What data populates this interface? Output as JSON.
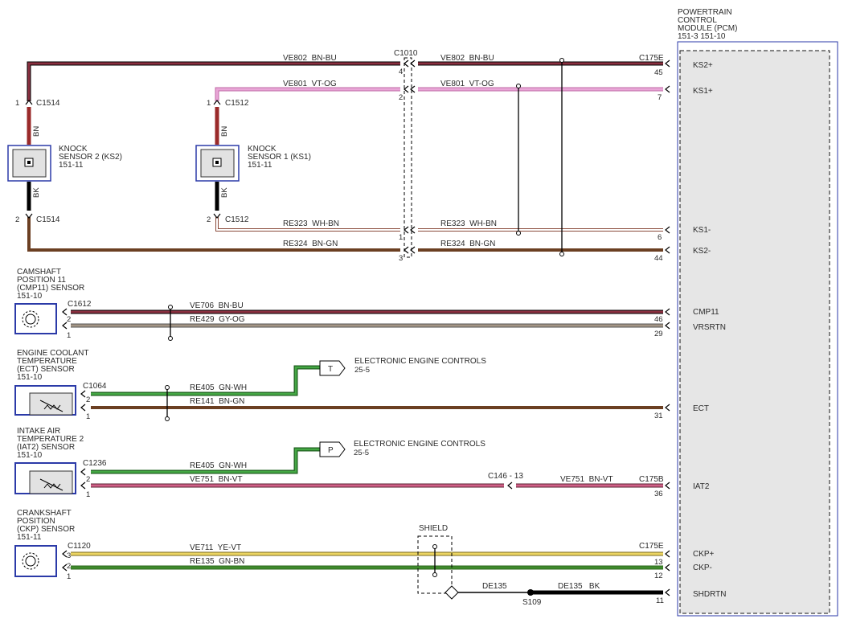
{
  "pcm": {
    "title_lines": [
      "POWERTRAIN",
      "CONTROL",
      "MODULE (PCM)",
      "151-3   151-10"
    ],
    "pins": [
      "KS2+",
      "KS1+",
      "KS1-",
      "KS2-",
      "CMP11",
      "VRSRTN",
      "ECT",
      "IAT2",
      "CKP+",
      "CKP-",
      "SHDRTN"
    ]
  },
  "knock_sensor_2": {
    "label_lines": [
      "KNOCK",
      "SENSOR 2 (KS2)",
      "151-11"
    ],
    "conn": "C1514",
    "pin_top": "1",
    "pin_bottom": "2",
    "wire_top_color": "BN",
    "wire_bottom_color": "BK"
  },
  "knock_sensor_1": {
    "label_lines": [
      "KNOCK",
      "SENSOR 1 (KS1)",
      "151-11"
    ],
    "conn": "C1512",
    "pin_top": "1",
    "pin_bottom": "2",
    "wire_top_color": "BN",
    "wire_bottom_color": "BK"
  },
  "c1010": {
    "name": "C1010",
    "pins": [
      "4",
      "2",
      "1",
      "3"
    ]
  },
  "c175e_top": {
    "name": "C175E",
    "pins": [
      "45",
      "7",
      "6",
      "44"
    ]
  },
  "ks_wires": [
    {
      "left": "VE802  BN-BU",
      "right": "VE802  BN-BU",
      "color": "#8a3040"
    },
    {
      "left": "VE801  VT-OG",
      "right": "VE801  VT-OG",
      "color": "#e79ad1"
    },
    {
      "left": "RE323  WH-BN",
      "right": "RE323  WH-BN",
      "color": "#ffffff"
    },
    {
      "left": "RE324  BN-GN",
      "right": "RE324  BN-GN",
      "color": "#7a4a2a"
    }
  ],
  "cmp_sensor": {
    "label_lines": [
      "CAMSHAFT",
      "POSITION 11",
      "(CMP11) SENSOR",
      "151-10"
    ],
    "conn": "C1612",
    "pins": [
      "2",
      "1"
    ],
    "wires": [
      {
        "circuit": "VE706  BN-BU",
        "pcm_pin": "46",
        "color": "#8a3040"
      },
      {
        "circuit": "RE429  GY-OG",
        "pcm_pin": "29",
        "color": "#9a8e80"
      }
    ]
  },
  "ect_sensor": {
    "label_lines": [
      "ENGINE COOLANT",
      "TEMPERATURE",
      "(ECT) SENSOR",
      "151-10"
    ],
    "conn": "C1064",
    "pins": [
      "2",
      "1"
    ],
    "wires": [
      {
        "circuit": "RE405  GN-WH",
        "color": "#2e8a2e"
      },
      {
        "circuit": "RE141  BN-GN",
        "pcm_pin": "31",
        "color": "#7a4a2a"
      }
    ],
    "tag": "T",
    "ref_title": "ELECTRONIC ENGINE CONTROLS",
    "ref_page": "25-5"
  },
  "iat_sensor": {
    "label_lines": [
      "INTAKE AIR",
      "TEMPERATURE 2",
      "(IAT2) SENSOR",
      "151-10"
    ],
    "conn": "C1236",
    "pins": [
      "2",
      "1"
    ],
    "wires": [
      {
        "circuit": "RE405  GN-WH",
        "color": "#2e8a2e"
      },
      {
        "circuit": "VE751  BN-VT",
        "color": "#c04d70"
      }
    ],
    "tag": "P",
    "ref_title": "ELECTRONIC ENGINE CONTROLS",
    "ref_page": "25-5",
    "inline_conn": "C146 - 13",
    "right_circuit": "VE751  BN-VT",
    "pcm_conn": "C175B",
    "pcm_pin": "36"
  },
  "ckp_sensor": {
    "label_lines": [
      "CRANKSHAFT",
      "POSITION",
      "(CKP) SENSOR",
      "151-11"
    ],
    "conn": "C1120",
    "pins": [
      "3",
      "2",
      "1"
    ],
    "pcm_conn": "C175E",
    "wires": [
      {
        "circuit": "VE711  YE-VT",
        "pcm_pin": "13",
        "color": "#e8cf57"
      },
      {
        "circuit": "RE135  GN-BN",
        "pcm_pin": "12",
        "color": "#3f7f2c"
      }
    ],
    "shield_label": "SHIELD",
    "shield_left_circuit": "DE135",
    "shield_right_circuit": "DE135   BK",
    "splice": "S109",
    "shield_pin": "11"
  }
}
